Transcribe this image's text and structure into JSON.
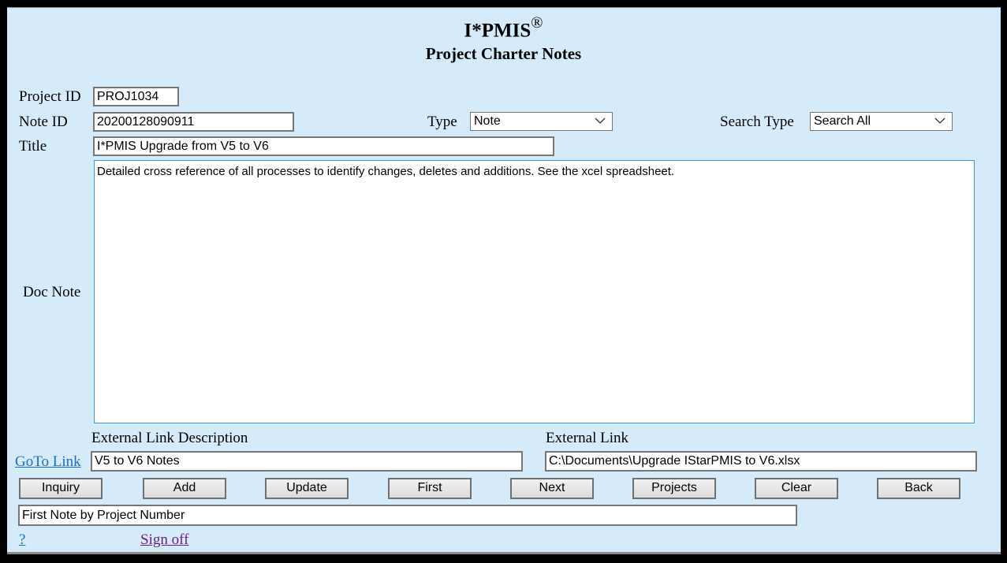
{
  "header": {
    "app_title": "I*PMIS",
    "registered_mark": "®",
    "page_title": "Project Charter Notes"
  },
  "form": {
    "project_id": {
      "label": "Project ID",
      "value": "PROJ1034"
    },
    "note_id": {
      "label": "Note ID",
      "value": "20200128090911"
    },
    "type": {
      "label": "Type",
      "selected": "Note"
    },
    "search_type": {
      "label": "Search Type",
      "selected": "Search All"
    },
    "title": {
      "label": "Title",
      "value": "I*PMIS Upgrade from V5 to V6"
    },
    "doc_note": {
      "label": "Doc Note",
      "value": "Detailed cross reference of all processes to identify changes, deletes and additions. See the xcel spreadsheet."
    },
    "external_link_description": {
      "label": "External Link Description",
      "value": "V5 to V6 Notes"
    },
    "external_link": {
      "label": "External Link",
      "value": "C:\\Documents\\Upgrade IStarPMIS to V6.xlsx"
    },
    "goto_link_label": "GoTo Link"
  },
  "buttons": {
    "inquiry": "Inquiry",
    "add": "Add",
    "update": "Update",
    "first": "First",
    "next": "Next",
    "projects": "Projects",
    "clear": "Clear",
    "back": "Back"
  },
  "status_message": "First Note by Project Number",
  "footer": {
    "help_link": "?",
    "sign_off_link": "Sign off"
  },
  "colors": {
    "page_background": "#d6ebfa",
    "link": "#1a6fc0",
    "visited_link": "#6b1d8c",
    "focus_border": "#2e9fd8"
  }
}
